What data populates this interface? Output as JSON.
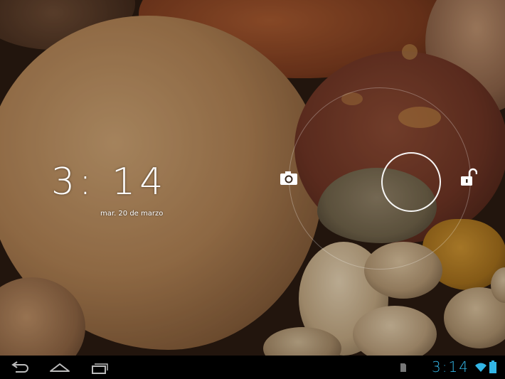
{
  "lockscreen": {
    "time": "3: 14",
    "date": "mar. 20 de marzo",
    "camera_icon": "camera-icon",
    "unlock_icon": "unlock-icon"
  },
  "statusbar": {
    "time": "3:14",
    "icons": [
      "sd-card-icon",
      "wifi-icon",
      "battery-icon"
    ]
  },
  "navbar": {
    "buttons": [
      "back-icon",
      "home-icon",
      "recent-apps-icon"
    ]
  },
  "colors": {
    "accent": "#33b5e5",
    "navbar_bg": "#000000"
  }
}
